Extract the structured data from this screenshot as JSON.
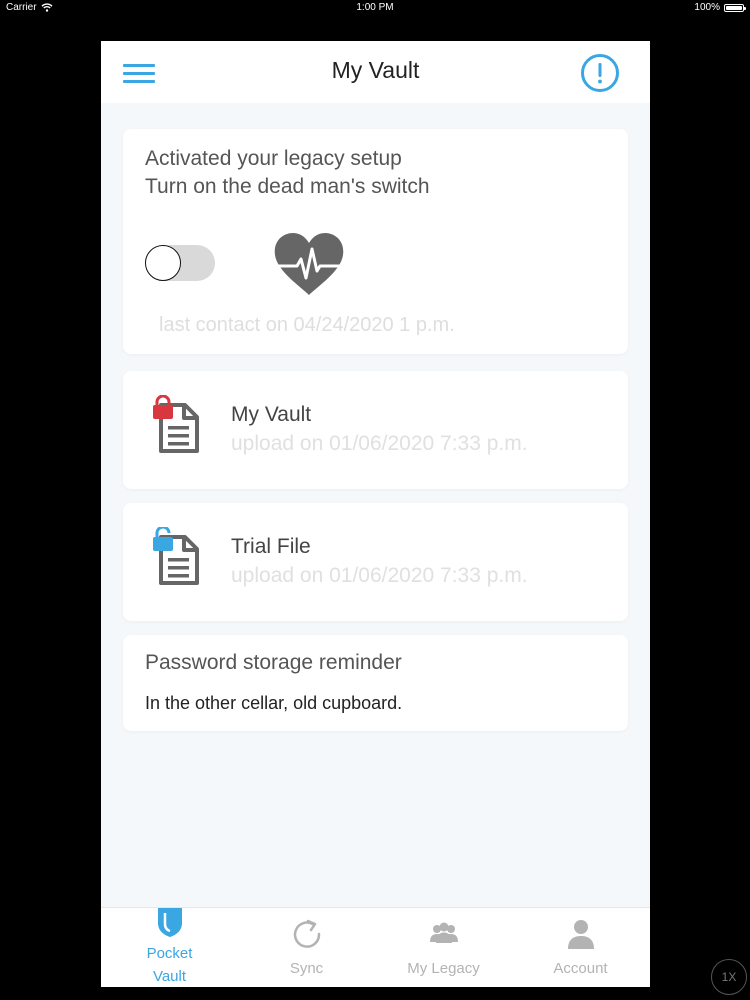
{
  "status_bar": {
    "carrier": "Carrier",
    "time": "1:00 PM",
    "battery": "100%"
  },
  "header": {
    "title": "My Vault",
    "menu_icon": "hamburger-icon",
    "alert_icon": "exclamation-circle-icon"
  },
  "legacy": {
    "line1": "Activated your legacy setup",
    "line2": "Turn on the dead man's switch",
    "switch_on": false,
    "heart_icon": "heartbeat-icon",
    "last_contact": "last contact on 04/24/2020 1 p.m."
  },
  "files": [
    {
      "name": "My Vault",
      "upload": "upload on 01/06/2020 7:33 p.m.",
      "icon": "locked-document-icon",
      "lock_color": "#d9373f"
    },
    {
      "name": "Trial File",
      "upload": "upload on 01/06/2020 7:33 p.m.",
      "icon": "unlocked-document-icon",
      "lock_color": "#3aa6e2"
    }
  ],
  "reminder": {
    "title": "Password storage reminder",
    "text": "In the other cellar, old cupboard."
  },
  "tabs": [
    {
      "label": "Pocket Vault",
      "line1": "Pocket",
      "line2": "Vault",
      "icon": "shield-icon",
      "active": true
    },
    {
      "label": "Sync",
      "icon": "refresh-icon",
      "active": false
    },
    {
      "label": "My Legacy",
      "icon": "group-icon",
      "active": false
    },
    {
      "label": "Account",
      "icon": "person-icon",
      "active": false
    }
  ],
  "zoom_badge": "1X",
  "colors": {
    "accent": "#3aa6e2",
    "lock_red": "#d9373f",
    "icon_gray": "#666666",
    "background": "#f4f8fa"
  }
}
